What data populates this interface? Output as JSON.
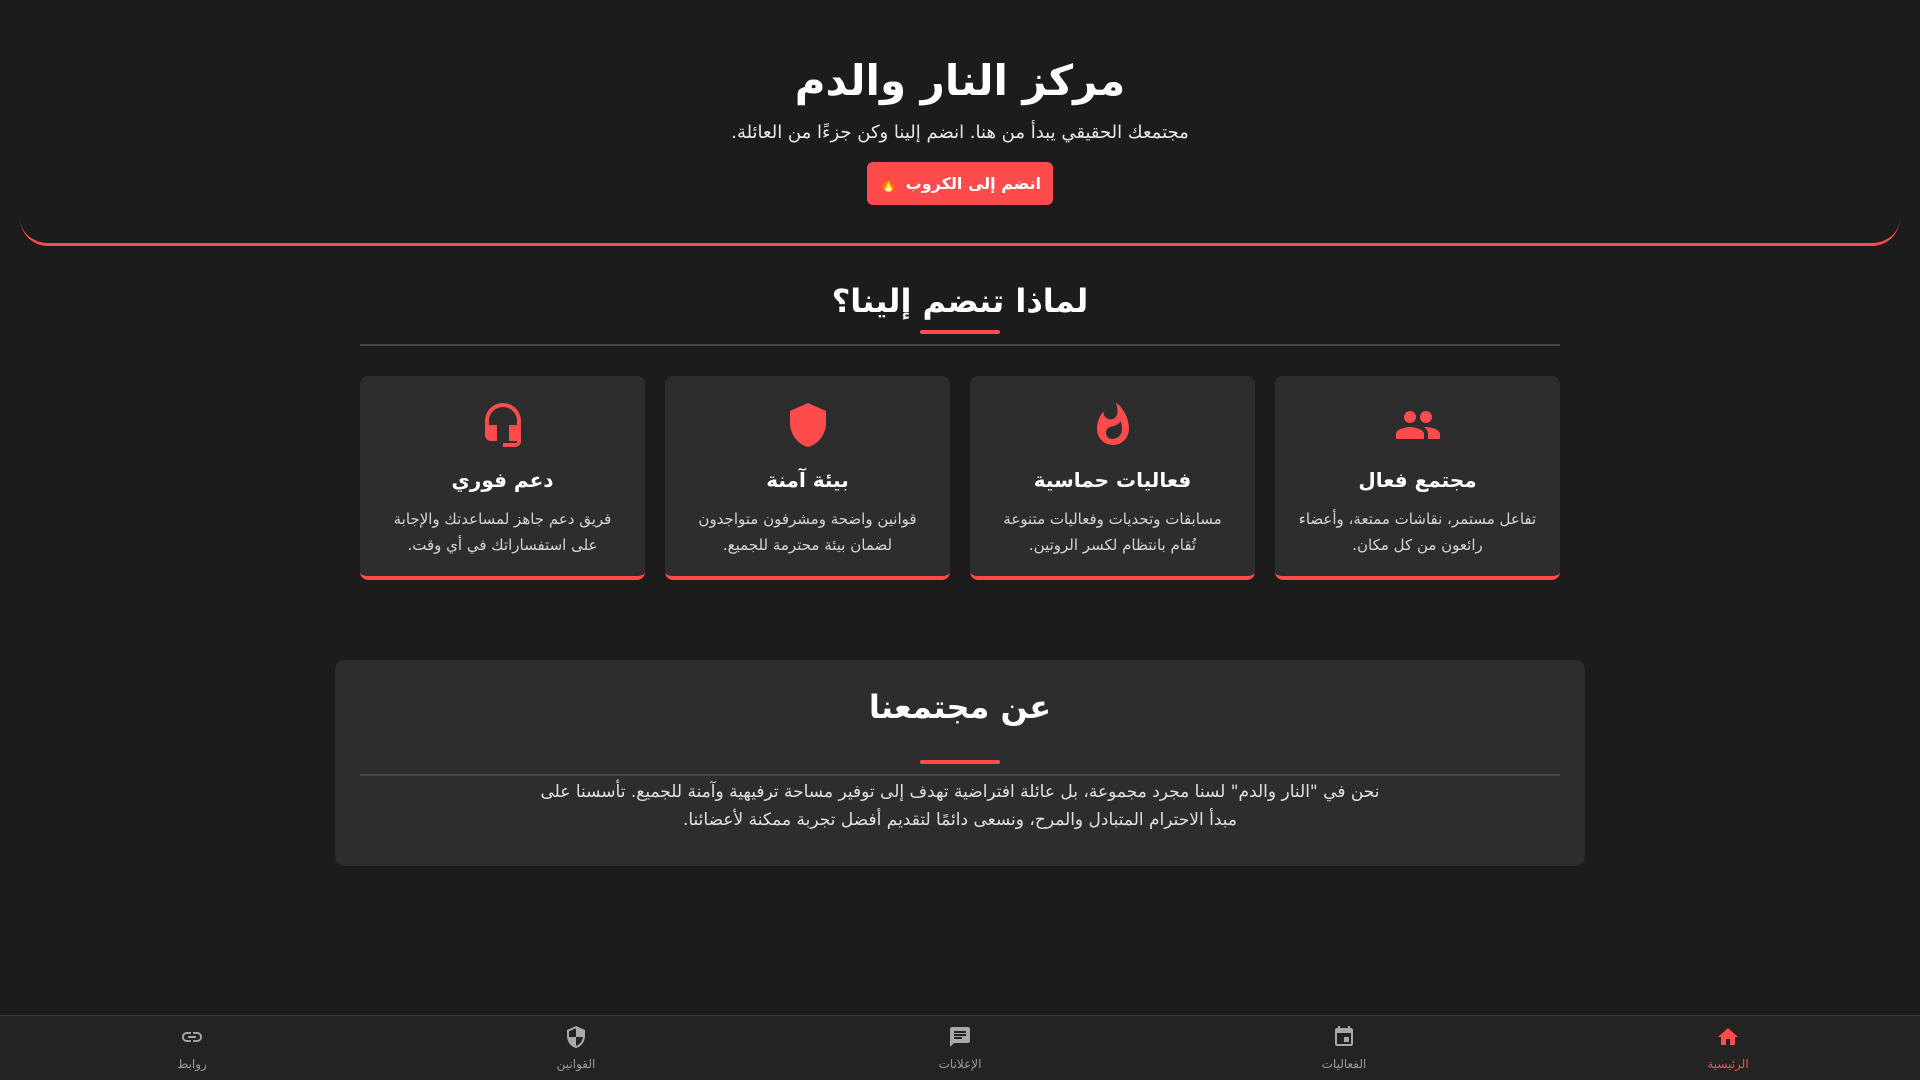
{
  "hero": {
    "title": "مركز النار والدم",
    "subtitle": "مجتمعك الحقيقي يبدأ من هنا. انضم إلينا وكن جزءًا من العائلة.",
    "join_label": "انضم إلى الكروب",
    "join_emoji": "🔥"
  },
  "why": {
    "heading": "لماذا تنضم إلينا؟",
    "cards": [
      {
        "icon": "group-icon",
        "title": "مجتمع فعال",
        "text": "تفاعل مستمر، نقاشات ممتعة، وأعضاء رائعون من كل مكان."
      },
      {
        "icon": "flame-icon",
        "title": "فعاليات حماسية",
        "text": "مسابقات وتحديات وفعاليات متنوعة تُقام بانتظام لكسر الروتين."
      },
      {
        "icon": "shield-icon",
        "title": "بيئة آمنة",
        "text": "قوانين واضحة ومشرفون متواجدون لضمان بيئة محترمة للجميع."
      },
      {
        "icon": "headset-icon",
        "title": "دعم فوري",
        "text": "فريق دعم جاهز لمساعدتك والإجابة على استفساراتك في أي وقت."
      }
    ]
  },
  "about": {
    "heading": "عن مجتمعنا",
    "text": "نحن في \"النار والدم\" لسنا مجرد مجموعة، بل عائلة افتراضية تهدف إلى توفير مساحة ترفيهية وآمنة للجميع. تأسسنا على مبدأ الاحترام المتبادل والمرح، ونسعى دائمًا لتقديم أفضل تجربة ممكنة لأعضائنا."
  },
  "nav": {
    "items": [
      {
        "icon": "home-icon",
        "label": "الرئيسية",
        "active": true
      },
      {
        "icon": "calendar-icon",
        "label": "الفعاليات",
        "active": false
      },
      {
        "icon": "chat-icon",
        "label": "الإعلانات",
        "active": false
      },
      {
        "icon": "shield-icon",
        "label": "القوانين",
        "active": false
      },
      {
        "icon": "link-icon",
        "label": "روابط",
        "active": false
      }
    ]
  },
  "colors": {
    "accent": "#ff4b4b",
    "background": "#1c1c1c",
    "card": "#2d2d2d"
  }
}
